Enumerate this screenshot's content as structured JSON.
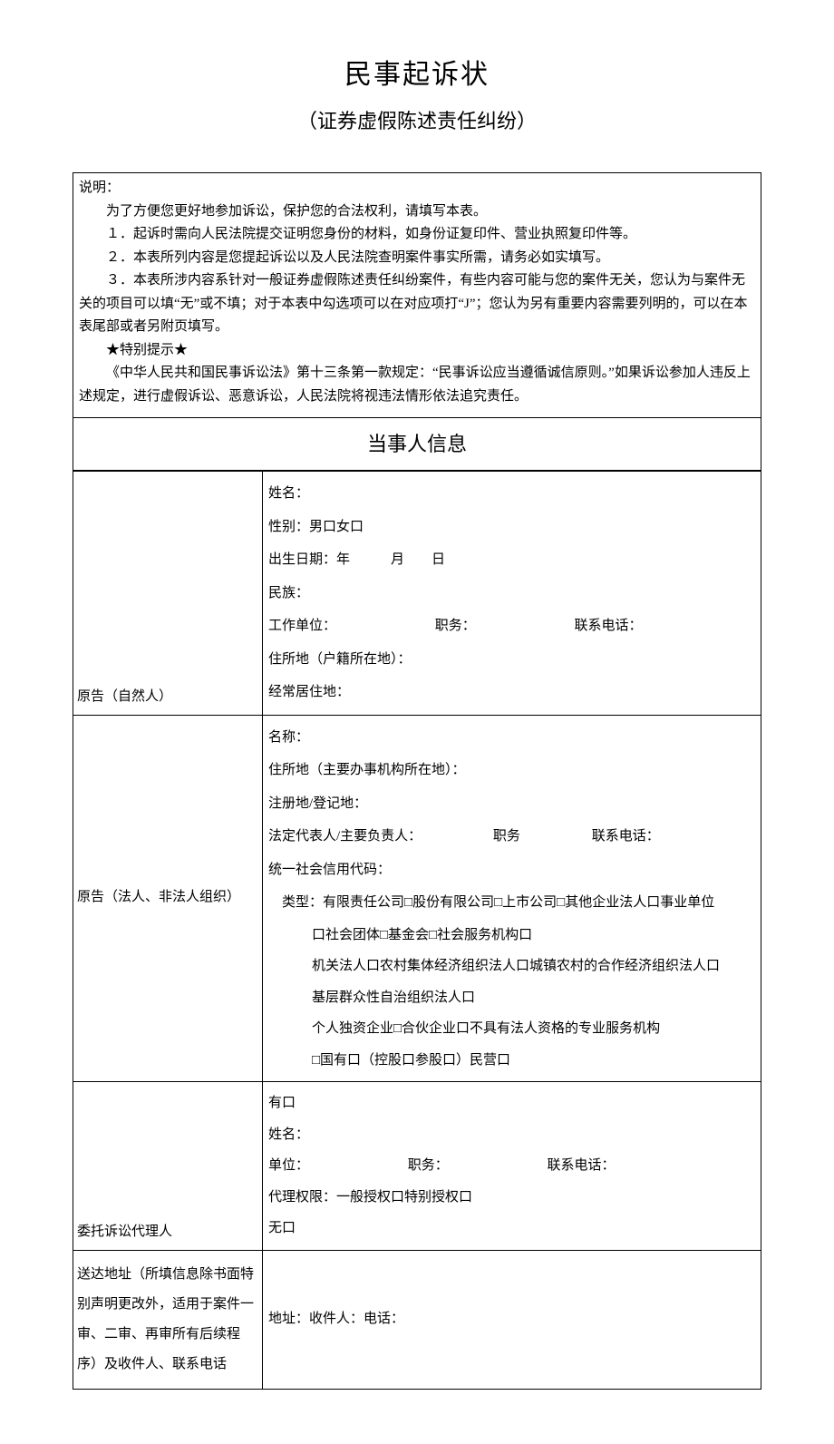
{
  "title": "民事起诉状",
  "subtitle": "（证券虚假陈述责任纠纷）",
  "notice": {
    "heading": "说明：",
    "p1": "为了方便您更好地参加诉讼，保护您的合法权利，请填写本表。",
    "p2": "１．起诉时需向人民法院提交证明您身份的材料，如身份证复印件、营业执照复印件等。",
    "p3": "２．本表所列内容是您提起诉讼以及人民法院查明案件事实所需，请务必如实填写。",
    "p4": "３．本表所涉内容系针对一般证券虚假陈述责任纠纷案件，有些内容可能与您的案件无关，您认为与案件无关的项目可以填“无”或不填；对于本表中勾选项可以在对应项打“J”；您认为另有重要内容需要列明的，可以在本表尾部或者另附页填写。",
    "tip_head": "★特别提示★",
    "tip_body": "《中华人民共和国民事诉讼法》第十三条第一款规定：“民事诉讼应当遵循诚信原则。”如果诉讼参加人违反上述规定，进行虚假诉讼、恶意诉讼，人民法院将视违法情形依法追究责任。"
  },
  "section_party": "当事人信息",
  "natural": {
    "side": "原告（自然人）",
    "name": "姓名：",
    "gender": "性别：男口女口",
    "dob": "出生日期：年　　　月　　日",
    "ethnic": "民族：",
    "work_unit": "工作单位：",
    "duty": "职务：",
    "phone": "联系电话：",
    "domicile": "住所地（户籍所在地）：",
    "residence": "经常居住地："
  },
  "legal": {
    "side": "原告（法人、非法人组织）",
    "name": "名称：",
    "domicile": "住所地（主要办事机构所在地）：",
    "reg": "注册地/登记地：",
    "rep": "法定代表人/主要负责人：",
    "duty": "职务",
    "phone": "联系电话：",
    "uscc": "统一社会信用代码：",
    "type_label": "　类型：",
    "type_l1": "有限责任公司□股份有限公司□上市公司□其他企业法人口事业单位",
    "type_l2": "口社会团体□基金会□社会服务机构口",
    "type_l3": "机关法人口农村集体经济组织法人口城镇农村的合作经济组织法人口",
    "type_l4": "基层群众性自治组织法人口",
    "type_l5": "个人独资企业□合伙企业口不具有法人资格的专业服务机构",
    "type_l6": "□国有口（控股口参股口）民营口"
  },
  "agent": {
    "side": "委托诉讼代理人",
    "has": "有口",
    "name": "姓名：",
    "unit": "单位：",
    "duty": "职务：",
    "phone": "联系电话：",
    "scope": "代理权限：一般授权口特别授权口",
    "none": "无口"
  },
  "delivery": {
    "side": "送达地址（所填信息除书面特别声明更改外，适用于案件一审、二审、再审所有后续程序）及收件人、联系电话",
    "content": "地址：收件人：电话："
  }
}
